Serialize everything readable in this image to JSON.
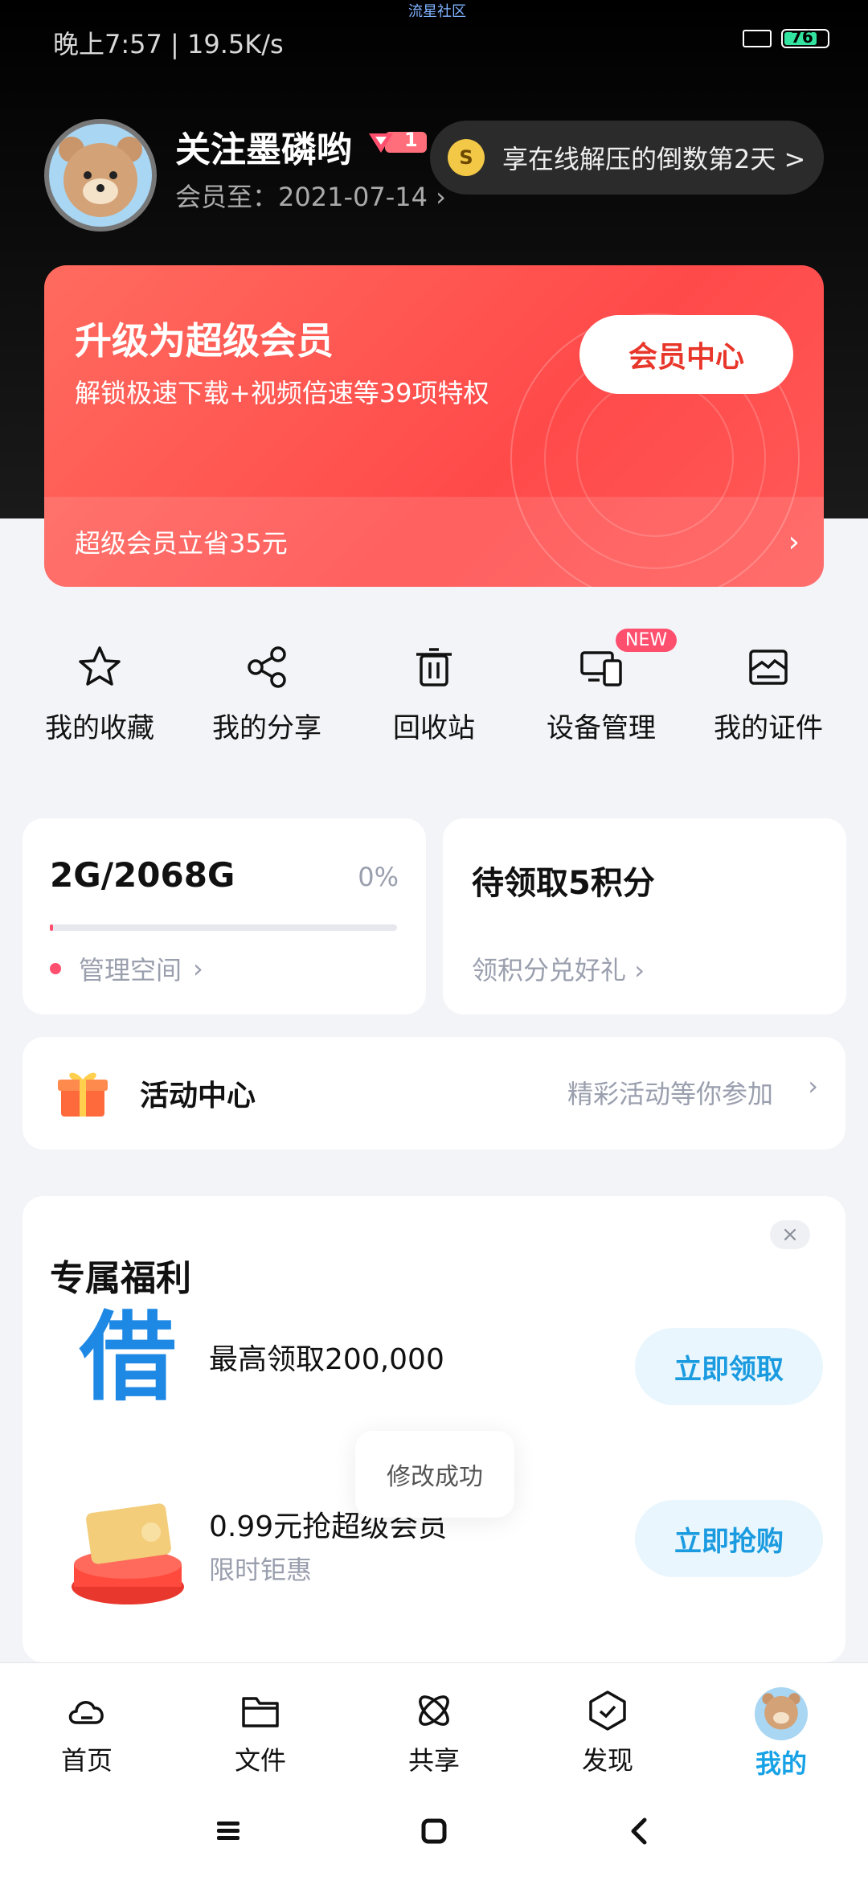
{
  "status": {
    "time_speed": "晚上7:57 | 19.5K/s",
    "carrier_center": "流星社区",
    "battery": "76"
  },
  "profile": {
    "username": "关注墨磷哟",
    "vip_level": "1",
    "member_until": "会员至：2021-07-14",
    "notice": "享在线解压的倒数第2天 >"
  },
  "upgrade_card": {
    "title": "升级为超级会员",
    "subtitle": "解锁极速下载+视频倍速等39项特权",
    "button": "会员中心",
    "footer": "超级会员立省35元"
  },
  "quick_actions": [
    {
      "label": "我的收藏",
      "icon": "star-icon"
    },
    {
      "label": "我的分享",
      "icon": "share-icon"
    },
    {
      "label": "回收站",
      "icon": "trash-icon"
    },
    {
      "label": "设备管理",
      "icon": "devices-icon",
      "badge": "NEW"
    },
    {
      "label": "我的证件",
      "icon": "id-card-icon"
    }
  ],
  "storage": {
    "amount": "2G/2068G",
    "percent": "0%",
    "used_fraction": 0.01,
    "manage_label": "管理空间",
    "accent": "#ff4f6e"
  },
  "points": {
    "title": "待领取5积分",
    "link": "领积分兑好礼"
  },
  "activity": {
    "title": "活动中心",
    "hint": "精彩活动等你参加"
  },
  "benefit": {
    "title": "专属福利",
    "close": "×",
    "rows": [
      {
        "icon_text": "借",
        "text": "最高领取200,000",
        "button": "立即领取"
      },
      {
        "text": "0.99元抢超级会员",
        "sub": "限时钜惠",
        "button": "立即抢购"
      }
    ]
  },
  "toast": "修改成功",
  "bottom_nav": [
    {
      "label": "首页",
      "icon": "cloud-icon"
    },
    {
      "label": "文件",
      "icon": "folder-icon"
    },
    {
      "label": "共享",
      "icon": "atom-icon"
    },
    {
      "label": "发现",
      "icon": "compass-icon"
    },
    {
      "label": "我的",
      "icon": "avatar",
      "active": true
    }
  ],
  "colors": {
    "brand_blue": "#18a2e6",
    "vip_red": "#ff4a4a",
    "badge_pink": "#ff4f6e"
  }
}
